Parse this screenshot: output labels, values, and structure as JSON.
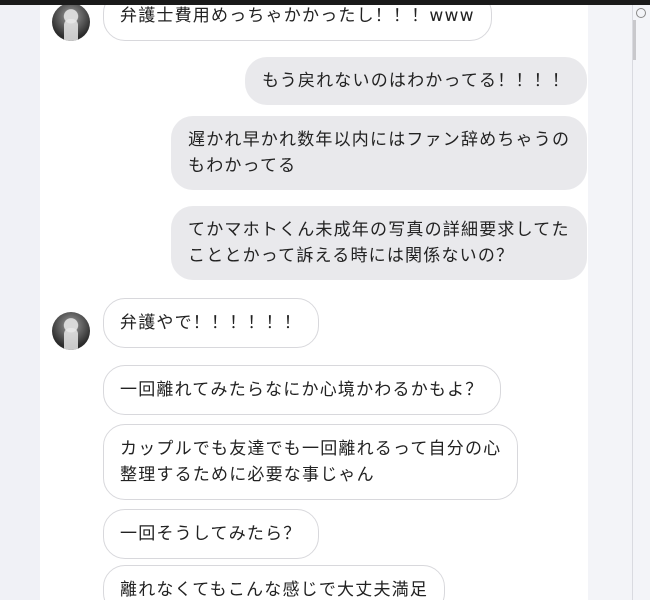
{
  "messages": [
    {
      "side": "in",
      "text": "弁護士費用めっちゃかかったし！！！www",
      "avatar": true
    },
    {
      "side": "out",
      "text": "もう戻れないのはわかってる！！！！"
    },
    {
      "side": "out",
      "text": "遅かれ早かれ数年以内にはファン辞めちゃうの\nもわかってる"
    },
    {
      "side": "out",
      "text": "てかマホトくん未成年の写真の詳細要求してた\nこととかって訴える時には関係ないの？"
    },
    {
      "side": "in",
      "text": "弁護やで！！！！！！",
      "avatar": true
    },
    {
      "side": "in",
      "text": "一回離れてみたらなにか心境かわるかもよ？"
    },
    {
      "side": "in",
      "text": "カップルでも友達でも一回離れるって自分の心\n整理するために必要な事じゃん"
    },
    {
      "side": "in",
      "text": "一回そうしてみたら？"
    },
    {
      "side": "in",
      "text": "離れなくてもこんな感じで大丈夫満足"
    }
  ]
}
